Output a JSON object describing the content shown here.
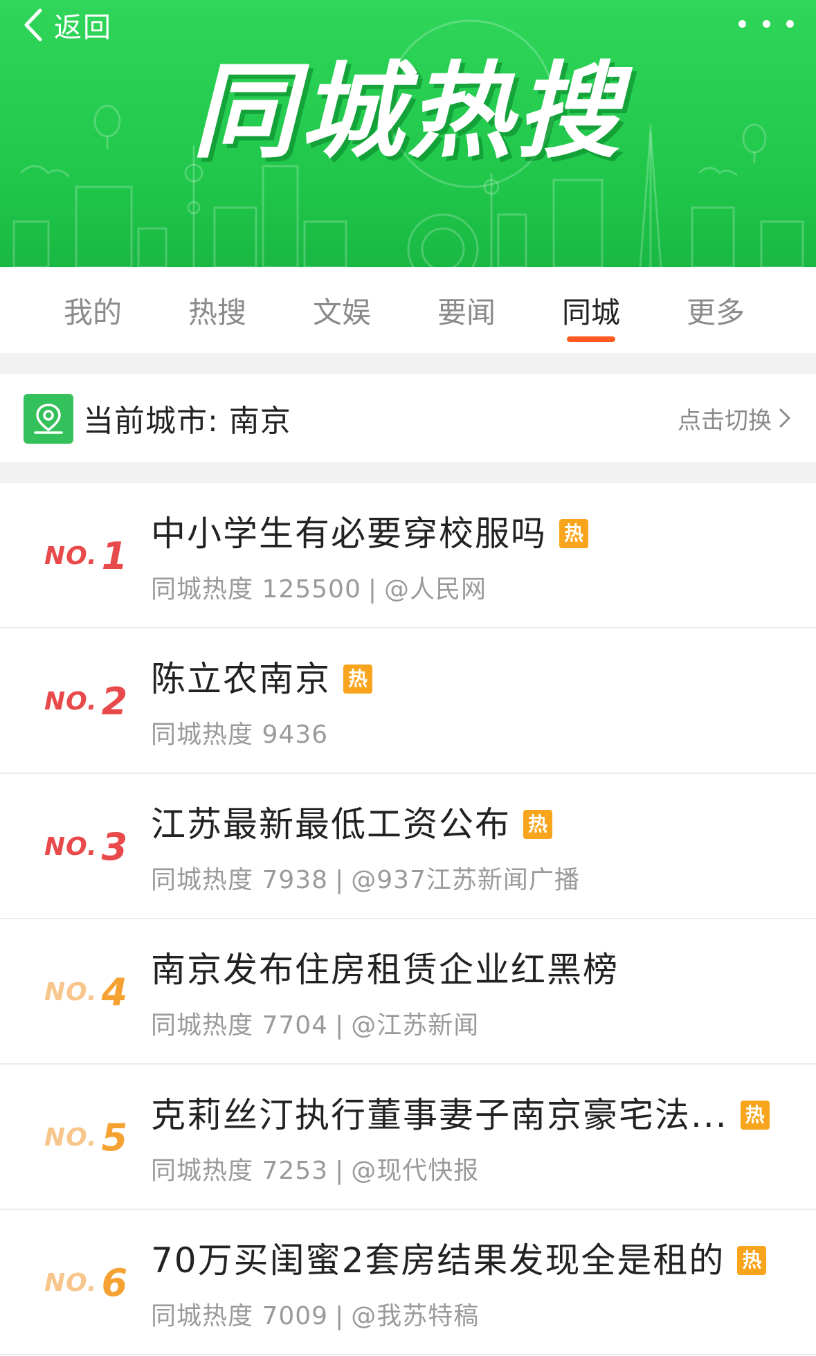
{
  "header": {
    "back_label": "返回",
    "banner_title": "同城热搜"
  },
  "tabs": [
    {
      "label": "我的",
      "active": false
    },
    {
      "label": "热搜",
      "active": false
    },
    {
      "label": "文娱",
      "active": false
    },
    {
      "label": "要闻",
      "active": false
    },
    {
      "label": "同城",
      "active": true
    },
    {
      "label": "更多",
      "active": false
    }
  ],
  "city": {
    "label": "当前城市: 南京",
    "switch_label": "点击切换"
  },
  "colors": {
    "banner_green": "#1fc649",
    "accent_orange": "#ff5a1f",
    "hot_badge": "#f8a41c",
    "rank_top": "#e8494a",
    "rank_mid": "#f5a233"
  },
  "list": {
    "items": [
      {
        "no": "NO.",
        "rank": "1",
        "title": "中小学生有必要穿校服吗",
        "hot": "热",
        "heat": "同城热度 125500",
        "sep": "|",
        "source": "@人民网"
      },
      {
        "no": "NO.",
        "rank": "2",
        "title": "陈立农南京",
        "hot": "热",
        "heat": "同城热度 9436",
        "sep": "",
        "source": ""
      },
      {
        "no": "NO.",
        "rank": "3",
        "title": "江苏最新最低工资公布",
        "hot": "热",
        "heat": "同城热度 7938",
        "sep": "|",
        "source": "@937江苏新闻广播"
      },
      {
        "no": "NO.",
        "rank": "4",
        "title": "南京发布住房租赁企业红黑榜",
        "hot": "",
        "heat": "同城热度 7704",
        "sep": "|",
        "source": "@江苏新闻"
      },
      {
        "no": "NO.",
        "rank": "5",
        "title": "克莉丝汀执行董事妻子南京豪宅法...",
        "hot": "热",
        "heat": "同城热度 7253",
        "sep": "|",
        "source": "@现代快报"
      },
      {
        "no": "NO.",
        "rank": "6",
        "title": "70万买闺蜜2套房结果发现全是租的",
        "hot": "热",
        "heat": "同城热度 7009",
        "sep": "|",
        "source": "@我苏特稿"
      }
    ]
  }
}
